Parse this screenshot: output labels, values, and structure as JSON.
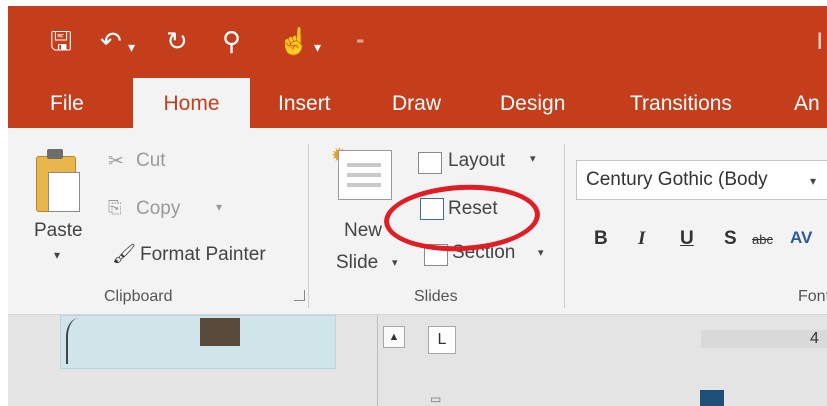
{
  "qat": {
    "save_icon": "save-icon",
    "undo_icon": "undo-icon",
    "redo_icon": "repeat-icon",
    "present_icon": "present-from-beginning-icon",
    "touch_icon": "touch-mode-icon",
    "customize_icon": "customize-qat-icon",
    "right_text": "I"
  },
  "tabs": {
    "file": "File",
    "home": "Home",
    "insert": "Insert",
    "draw": "Draw",
    "design": "Design",
    "transitions": "Transitions",
    "animations_partial": "An"
  },
  "clipboard": {
    "cut": "Cut",
    "copy": "Copy",
    "paste": "Paste",
    "format_painter": "Format Painter",
    "group_label": "Clipboard"
  },
  "slides": {
    "new_line1": "New",
    "new_line2": "Slide",
    "layout": "Layout",
    "reset": "Reset",
    "section": "Section",
    "group_label": "Slides"
  },
  "font": {
    "font_name": "Century Gothic (Body",
    "bold": "B",
    "italic": "I",
    "underline": "U",
    "shadow": "S",
    "strikethrough": "abc",
    "spacing": "AV",
    "group_label_partial": "Font"
  },
  "workspace": {
    "tab_stop_label": "L",
    "ruler_number": "4"
  },
  "colors": {
    "accent": "#c43e1c",
    "highlight": "#e01d24"
  }
}
